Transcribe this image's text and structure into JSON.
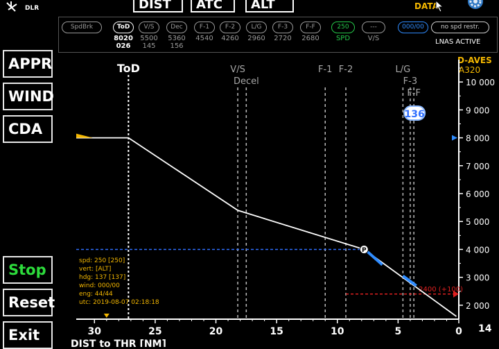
{
  "header": {
    "logo_text": "DLR",
    "tabs": [
      {
        "label": "DIST"
      },
      {
        "label": "ATC"
      },
      {
        "label": "ALT"
      }
    ],
    "data_label": "DATA"
  },
  "status_strip": {
    "speedbrake": "SpdBrk",
    "checkpoints": [
      {
        "label": "ToD",
        "v1": "8020",
        "v2": "026"
      },
      {
        "label": "V/S",
        "v1": "5500",
        "v2": "145"
      },
      {
        "label": "Dec",
        "v1": "5360",
        "v2": "156"
      },
      {
        "label": "F-1",
        "v1": "4540",
        "v2": ""
      },
      {
        "label": "F-2",
        "v1": "4260",
        "v2": ""
      },
      {
        "label": "L/G",
        "v1": "2960",
        "v2": ""
      },
      {
        "label": "F-3",
        "v1": "2720",
        "v2": ""
      },
      {
        "label": "F-F",
        "v1": "2680",
        "v2": ""
      }
    ],
    "speed_pill": "250",
    "speed_caption": "SPD",
    "vs_pill": "---",
    "vs_caption": "V/S",
    "fuel_pill": "000/00",
    "restriction_pill": "no spd restr.",
    "lnas_status": "LNAS ACTIVE"
  },
  "sidebar": {
    "top_buttons": [
      "APPR",
      "WIND",
      "CDA"
    ],
    "bottom_buttons": [
      "Stop",
      "Reset",
      "Exit"
    ]
  },
  "aircraft": {
    "callsign": "D-AVES",
    "type": "A320"
  },
  "profile": {
    "markers": [
      {
        "label": "ToD",
        "dist": 27.2
      },
      {
        "label": "V/S",
        "dist": 18.2
      },
      {
        "label": "Decel",
        "dist": 17.5
      },
      {
        "label": "F-1",
        "dist": 11.0
      },
      {
        "label": "F-2",
        "dist": 9.3
      },
      {
        "label": "L/G",
        "dist": 4.6
      },
      {
        "label": "F-3",
        "dist": 4.0
      },
      {
        "label": "F-F",
        "dist": 3.7
      }
    ],
    "current_speed_badge": "136",
    "waypoint_label": "P",
    "target_alt_label": "2400 (+100)",
    "info": [
      "spd: 250 [250]",
      "vert: [ALT]",
      "hdg: 137 [137]",
      "wind: 000/00",
      "eng: 44/44",
      "utc: 2019-08-07 02:18:18"
    ],
    "trailing_number": "14"
  },
  "chart_data": {
    "type": "line",
    "xlabel": "DIST to THR [NM]",
    "ylabel": "",
    "xlim": [
      31.5,
      0
    ],
    "ylim": [
      1500,
      10800
    ],
    "x_ticks": [
      30,
      25,
      20,
      15,
      10,
      5,
      0
    ],
    "y_ticks": [
      2000,
      3000,
      4000,
      5000,
      6000,
      7000,
      8000,
      9000,
      10000
    ],
    "y_tick_labels": [
      "2 000",
      "3 000",
      "4 000",
      "5 000",
      "6 000",
      "7 000",
      "8 000",
      "9 000",
      "10 000"
    ],
    "series": [
      {
        "name": "",
        "x": [
          31.5,
          27.2,
          18.2,
          7.8,
          0.2
        ],
        "y": [
          8000,
          8000,
          5400,
          4000,
          1600
        ]
      }
    ],
    "aircraft_altitude": 4000,
    "selected_altitude_marker": 8000,
    "target_altitude": 2400
  }
}
